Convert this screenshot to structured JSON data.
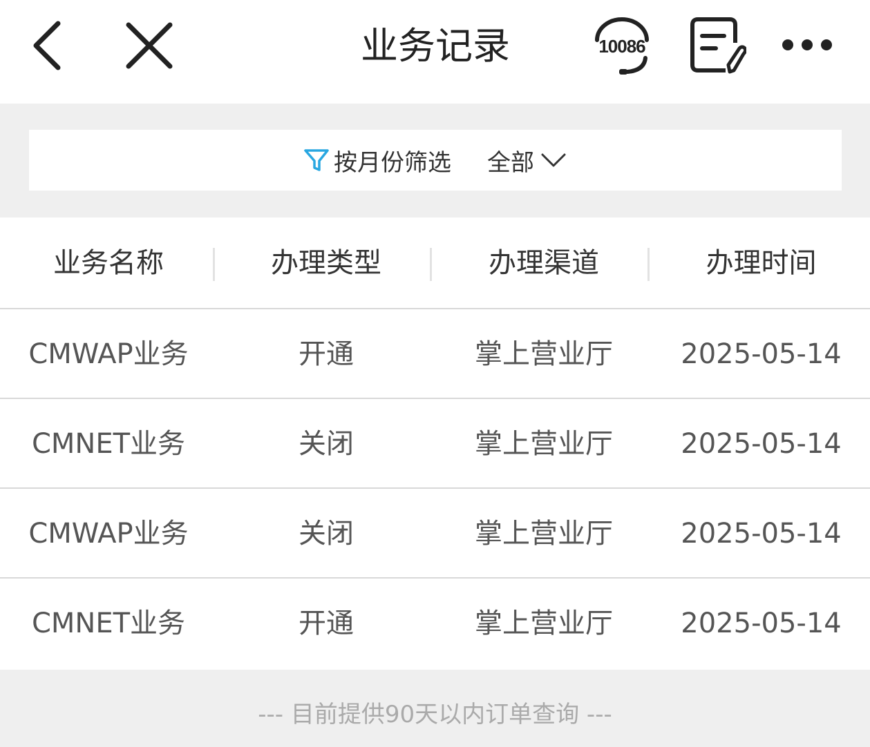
{
  "header": {
    "title": "业务记录",
    "hotline_number": "10086",
    "icons": {
      "back": "chevron-left-icon",
      "close": "close-icon",
      "hotline": "headset-hotline-icon",
      "note": "edit-note-icon",
      "more": "more-dots-icon"
    }
  },
  "filter": {
    "label": "按月份筛选",
    "value": "全部",
    "icon": "filter-icon",
    "accent": "#29a7e1"
  },
  "table": {
    "columns": [
      "业务名称",
      "办理类型",
      "办理渠道",
      "办理时间"
    ],
    "rows": [
      [
        "CMWAP业务",
        "开通",
        "掌上营业厅",
        "2025-05-14"
      ],
      [
        "CMNET业务",
        "关闭",
        "掌上营业厅",
        "2025-05-14"
      ],
      [
        "CMWAP业务",
        "关闭",
        "掌上营业厅",
        "2025-05-14"
      ],
      [
        "CMNET业务",
        "开通",
        "掌上营业厅",
        "2025-05-14"
      ]
    ]
  },
  "footer": {
    "note": "--- 目前提供90天以内订单查询 ---"
  }
}
